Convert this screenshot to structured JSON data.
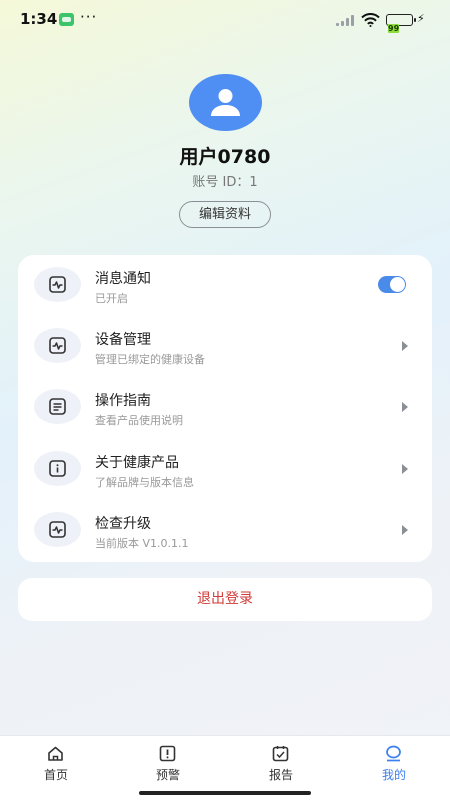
{
  "status_bar": {
    "time": "1:34",
    "battery": "99"
  },
  "profile": {
    "username": "用户0780",
    "account_id": "账号 ID：1",
    "edit_label": "编辑资料"
  },
  "menu": {
    "items": [
      {
        "title": "消息通知",
        "subtitle": "已开启",
        "icon": "pulse-icon",
        "toggle_on": true
      },
      {
        "title": "设备管理",
        "subtitle": "管理已绑定的健康设备",
        "icon": "pulse-icon"
      },
      {
        "title": "操作指南",
        "subtitle": "查看产品使用说明",
        "icon": "document-icon"
      },
      {
        "title": "关于健康产品",
        "subtitle": "了解品牌与版本信息",
        "icon": "info-icon"
      },
      {
        "title": "检查升级",
        "subtitle": "当前版本 V1.0.1.1",
        "icon": "pulse-icon"
      }
    ]
  },
  "logout_label": "退出登录",
  "tabs": [
    {
      "label": "首页",
      "icon": "home-icon"
    },
    {
      "label": "预警",
      "icon": "alert-icon"
    },
    {
      "label": "报告",
      "icon": "report-icon"
    },
    {
      "label": "我的",
      "icon": "profile-icon",
      "active": true
    }
  ],
  "colors": {
    "accent": "#3d7ff0",
    "avatar": "#4f8ef2",
    "danger": "#d23a36"
  }
}
